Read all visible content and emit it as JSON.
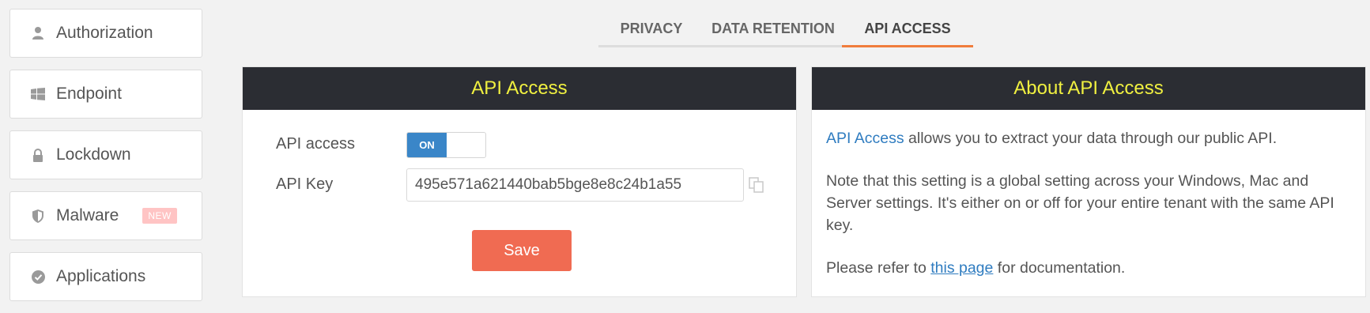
{
  "sidebar": {
    "items": [
      {
        "label": "Authorization",
        "icon": "user-icon"
      },
      {
        "label": "Endpoint",
        "icon": "windows-icon"
      },
      {
        "label": "Lockdown",
        "icon": "lock-icon"
      },
      {
        "label": "Malware",
        "icon": "shield-icon",
        "badge": "NEW"
      },
      {
        "label": "Applications",
        "icon": "check-circle-icon"
      }
    ]
  },
  "tabs": [
    {
      "label": "PRIVACY",
      "active": false
    },
    {
      "label": "DATA RETENTION",
      "active": false
    },
    {
      "label": "API ACCESS",
      "active": true
    }
  ],
  "api_panel": {
    "title": "API Access",
    "api_access_label": "API access",
    "toggle_state": "ON",
    "api_key_label": "API Key",
    "api_key_value": "495e571a621440bab5bge8e8c24b1a55",
    "save_label": "Save"
  },
  "about_panel": {
    "title": "About API Access",
    "p1_highlight": "API Access",
    "p1_rest": " allows you to extract your data through our public API.",
    "p2": "Note that this setting is a global setting across your Windows, Mac and Server settings. It's either on or off for your entire tenant with the same API key.",
    "p3_before": "Please refer to ",
    "p3_link": "this page",
    "p3_after": " for documentation."
  },
  "colors": {
    "accent_orange": "#f07d3c",
    "header_bg": "#2b2d33",
    "header_text": "#f0f040",
    "toggle_on": "#3a86c8",
    "save_button": "#f06b52",
    "link": "#2f7cc0"
  }
}
